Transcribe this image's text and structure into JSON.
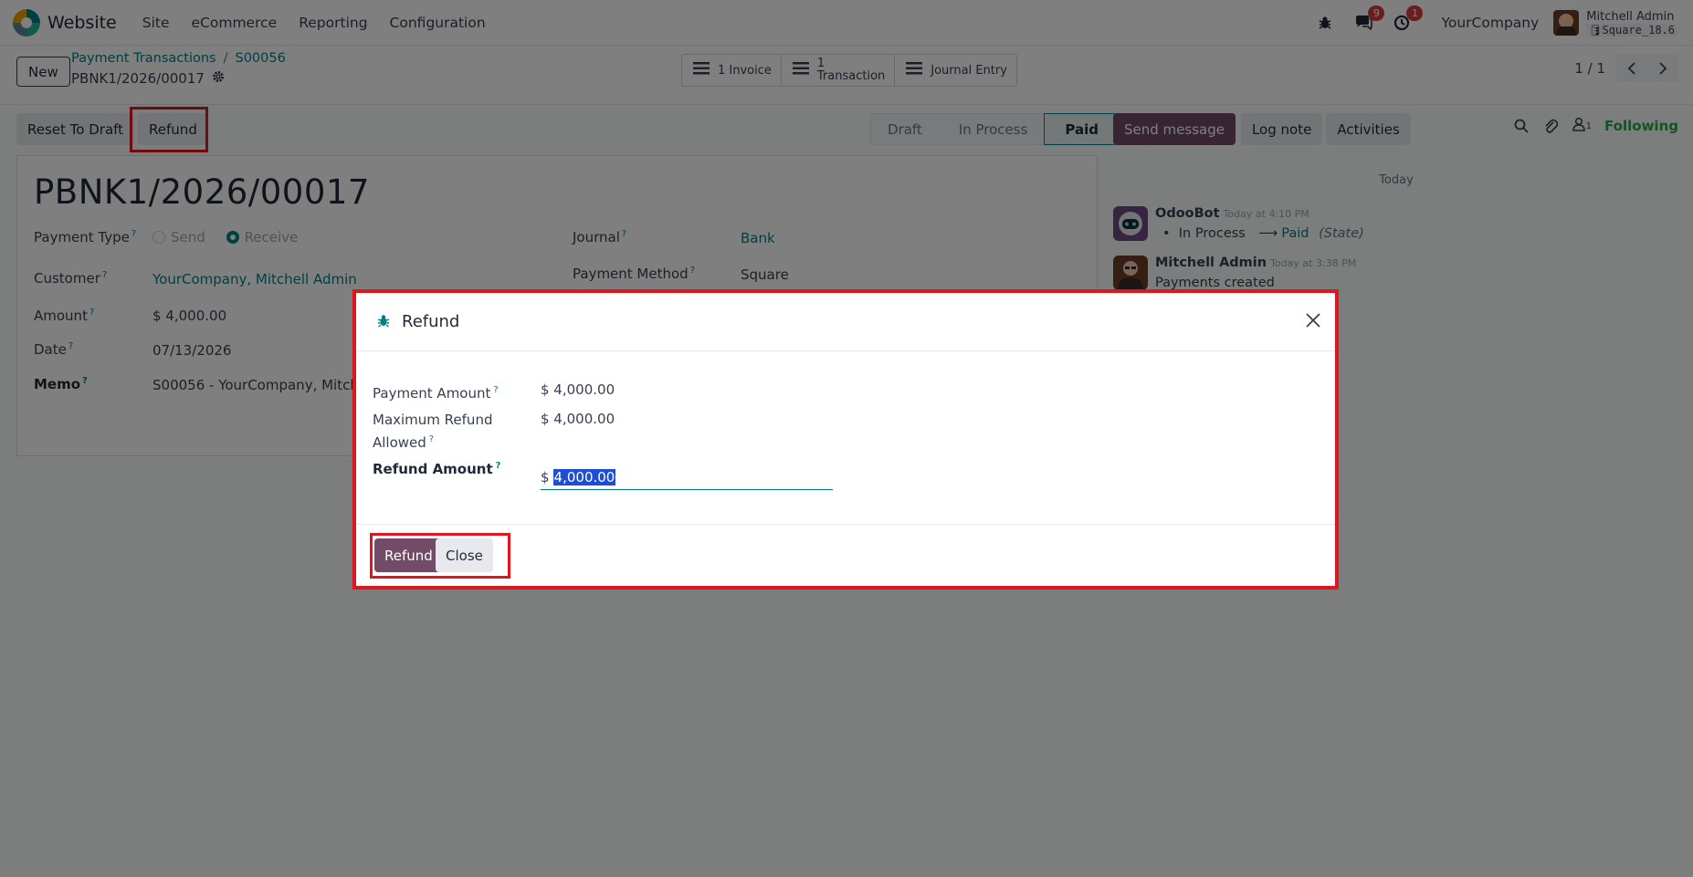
{
  "navbar": {
    "app_name": "Website",
    "menu": [
      "Site",
      "eCommerce",
      "Reporting",
      "Configuration"
    ],
    "messages_count": "9",
    "activities_count": "1",
    "company": "YourCompany",
    "user_name": "Mitchell Admin",
    "database": "Square_18.6"
  },
  "control_panel": {
    "new_label": "New",
    "breadcrumb": [
      "Payment Transactions",
      "S00056"
    ],
    "record_name": "PBNK1/2026/00017",
    "smart_buttons": {
      "invoice": "1 Invoice",
      "transaction_count": "1",
      "transaction_label": "Transaction",
      "journal_entry": "Journal Entry"
    },
    "pager": "1 / 1"
  },
  "statusbar": {
    "reset_label": "Reset To Draft",
    "refund_label": "Refund",
    "stages": [
      "Draft",
      "In Process",
      "Paid"
    ],
    "active_stage": "Paid"
  },
  "form": {
    "title": "PBNK1/2026/00017",
    "payment_type_label": "Payment Type",
    "payment_type_options": [
      "Send",
      "Receive"
    ],
    "payment_type_selected": "Receive",
    "customer_label": "Customer",
    "customer_value": "YourCompany, Mitchell Admin",
    "amount_label": "Amount",
    "amount_value": "$ 4,000.00",
    "date_label": "Date",
    "date_value": "07/13/2026",
    "memo_label": "Memo",
    "memo_value": "S00056 - YourCompany, Mitchel",
    "journal_label": "Journal",
    "journal_value": "Bank",
    "payment_method_label": "Payment Method",
    "payment_method_value": "Square",
    "help_mark": "?"
  },
  "chatter": {
    "send_message": "Send message",
    "log_note": "Log note",
    "activities": "Activities",
    "followers_count": "1",
    "following": "Following",
    "day": "Today",
    "messages": [
      {
        "author": "OdooBot",
        "date": "Today at 4:10 PM",
        "from_state": "In Process",
        "arrow": "⟶",
        "to_state": "Paid",
        "field": "(State)"
      },
      {
        "author": "Mitchell Admin",
        "date": "Today at 3:38 PM",
        "body": "Payments created"
      }
    ]
  },
  "modal": {
    "title": "Refund",
    "payment_amount_label": "Payment Amount",
    "payment_amount_value": "$ 4,000.00",
    "max_refund_label_1": "Maximum Refund",
    "max_refund_label_2": "Allowed",
    "max_refund_value": "$ 4,000.00",
    "refund_amount_label": "Refund Amount",
    "currency_symbol": "$",
    "refund_amount_value": "4,000.00",
    "refund_button": "Refund",
    "close_button": "Close"
  },
  "colors": {
    "primary": "#714b67",
    "link": "#017e84",
    "highlight": "#e0161e",
    "following": "#28a745",
    "badge": "#d23f3a"
  },
  "icons": [
    "bug-icon",
    "chat-icon",
    "clock-icon",
    "gear-icon",
    "list-icon",
    "chevron-left-icon",
    "chevron-right-icon",
    "search-icon",
    "paperclip-icon",
    "user-icon",
    "close-icon"
  ]
}
